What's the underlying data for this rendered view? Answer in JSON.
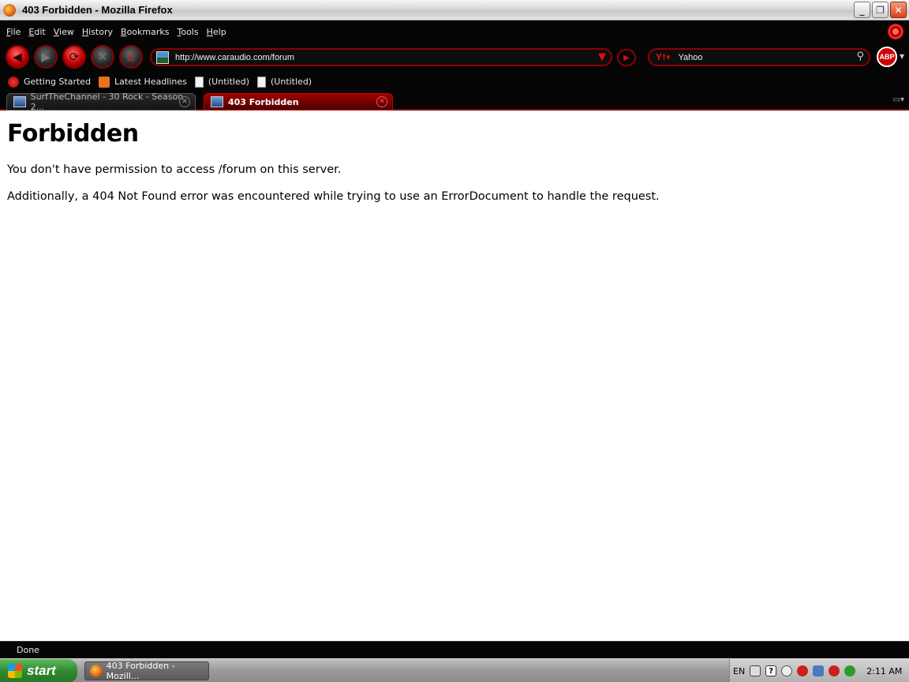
{
  "window": {
    "title": "403 Forbidden - Mozilla Firefox"
  },
  "menu": {
    "items": [
      {
        "label": "File"
      },
      {
        "label": "Edit"
      },
      {
        "label": "View"
      },
      {
        "label": "History"
      },
      {
        "label": "Bookmarks"
      },
      {
        "label": "Tools"
      },
      {
        "label": "Help"
      }
    ]
  },
  "nav": {
    "url": "http://www.caraudio.com/forum",
    "search_engine": "Yahoo",
    "abp_label": "ABP"
  },
  "bookmarks": {
    "items": [
      {
        "label": "Getting Started",
        "icon": "firefox-bookmark-icon"
      },
      {
        "label": "Latest Headlines",
        "icon": "rss-icon"
      },
      {
        "label": "(Untitled)",
        "icon": "page-icon"
      },
      {
        "label": "(Untitled)",
        "icon": "page-icon"
      }
    ]
  },
  "tabs": [
    {
      "label": "SurfTheChannel - 30 Rock - Season 2...",
      "active": false
    },
    {
      "label": "403 Forbidden",
      "active": true
    }
  ],
  "page": {
    "heading": "Forbidden",
    "para1": "You don't have permission to access /forum on this server.",
    "para2": "Additionally, a 404 Not Found error was encountered while trying to use an ErrorDocument to handle the request."
  },
  "status": {
    "text": "Done"
  },
  "taskbar": {
    "start_label": "start",
    "task_label": "403 Forbidden - Mozill...",
    "lang": "EN",
    "help_glyph": "?",
    "clock": "2:11 AM"
  },
  "colors": {
    "accent": "#cc0000",
    "chrome_bg": "#050505",
    "page_bg": "#ffffff"
  }
}
